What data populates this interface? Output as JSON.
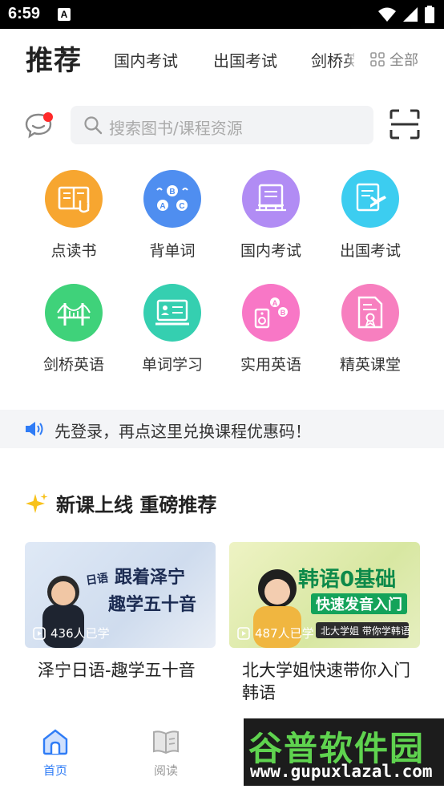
{
  "status_bar": {
    "time": "6:59",
    "notif_letter": "A"
  },
  "tabs": {
    "active": "推荐",
    "items": [
      "国内考试",
      "出国考试",
      "剑桥英"
    ],
    "all_label": "全部"
  },
  "search": {
    "placeholder": "搜索图书/课程资源"
  },
  "categories": [
    {
      "label": "点读书",
      "icon": "book-point-icon",
      "color": "#f7a630"
    },
    {
      "label": "背单词",
      "icon": "abc-icon",
      "color": "#4f8ef0"
    },
    {
      "label": "国内考试",
      "icon": "exam-domestic-icon",
      "color": "#b18cf4"
    },
    {
      "label": "出国考试",
      "icon": "plane-doc-icon",
      "color": "#3ccdf0"
    },
    {
      "label": "剑桥英语",
      "icon": "bridge-icon",
      "color": "#3fd27a"
    },
    {
      "label": "单词学习",
      "icon": "word-card-icon",
      "color": "#35cfb0"
    },
    {
      "label": "实用英语",
      "icon": "speaker-ab-icon",
      "color": "#f877c6"
    },
    {
      "label": "精英课堂",
      "icon": "certificate-icon",
      "color": "#f77fbf"
    }
  ],
  "notice": {
    "text": "先登录，再点这里兑换课程优惠码！"
  },
  "section": {
    "title": "新课上线 重磅推荐"
  },
  "courses": [
    {
      "title": "泽宁日语-趣学五十音",
      "learners": "436人已学",
      "thumb_heading": "跟着泽宁",
      "thumb_sub": "趣学五十音",
      "thumb_tag": "日语"
    },
    {
      "title": "北大学姐快速带你入门韩语",
      "learners": "487人已学",
      "thumb_heading": "韩语0基础",
      "thumb_sub": "快速发音入门",
      "thumb_tag": "北大学姐 带你学韩语"
    }
  ],
  "bottom_nav": [
    {
      "label": "首页",
      "active": true
    },
    {
      "label": "阅读",
      "active": false
    }
  ],
  "watermark": {
    "title": "谷普软件园",
    "url": "www.gupuxlazal.com"
  },
  "colors": {
    "accent": "#2f7cf6",
    "dot": "#ff2a2a"
  }
}
